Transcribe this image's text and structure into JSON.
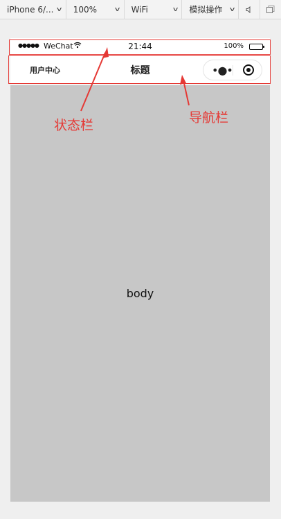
{
  "toolbar": {
    "device": "iPhone 6/...",
    "zoom": "100%",
    "network": "WiFi",
    "simulate": "模拟操作",
    "sound_icon": "speaker-icon",
    "window_icon": "window-icon"
  },
  "statusbar": {
    "signal": "●●●●●",
    "carrier": "WeChat",
    "time": "21:44",
    "battery_percent": "100%",
    "battery_level": 1.0
  },
  "navbar": {
    "left_label": "用户中心",
    "title": "标题",
    "capsule_more": "•●•"
  },
  "content": {
    "body_label": "body",
    "background_color": "#c7c7c7"
  },
  "annotations": {
    "status_label": "状态栏",
    "nav_label": "导航栏",
    "color": "#e53935"
  }
}
